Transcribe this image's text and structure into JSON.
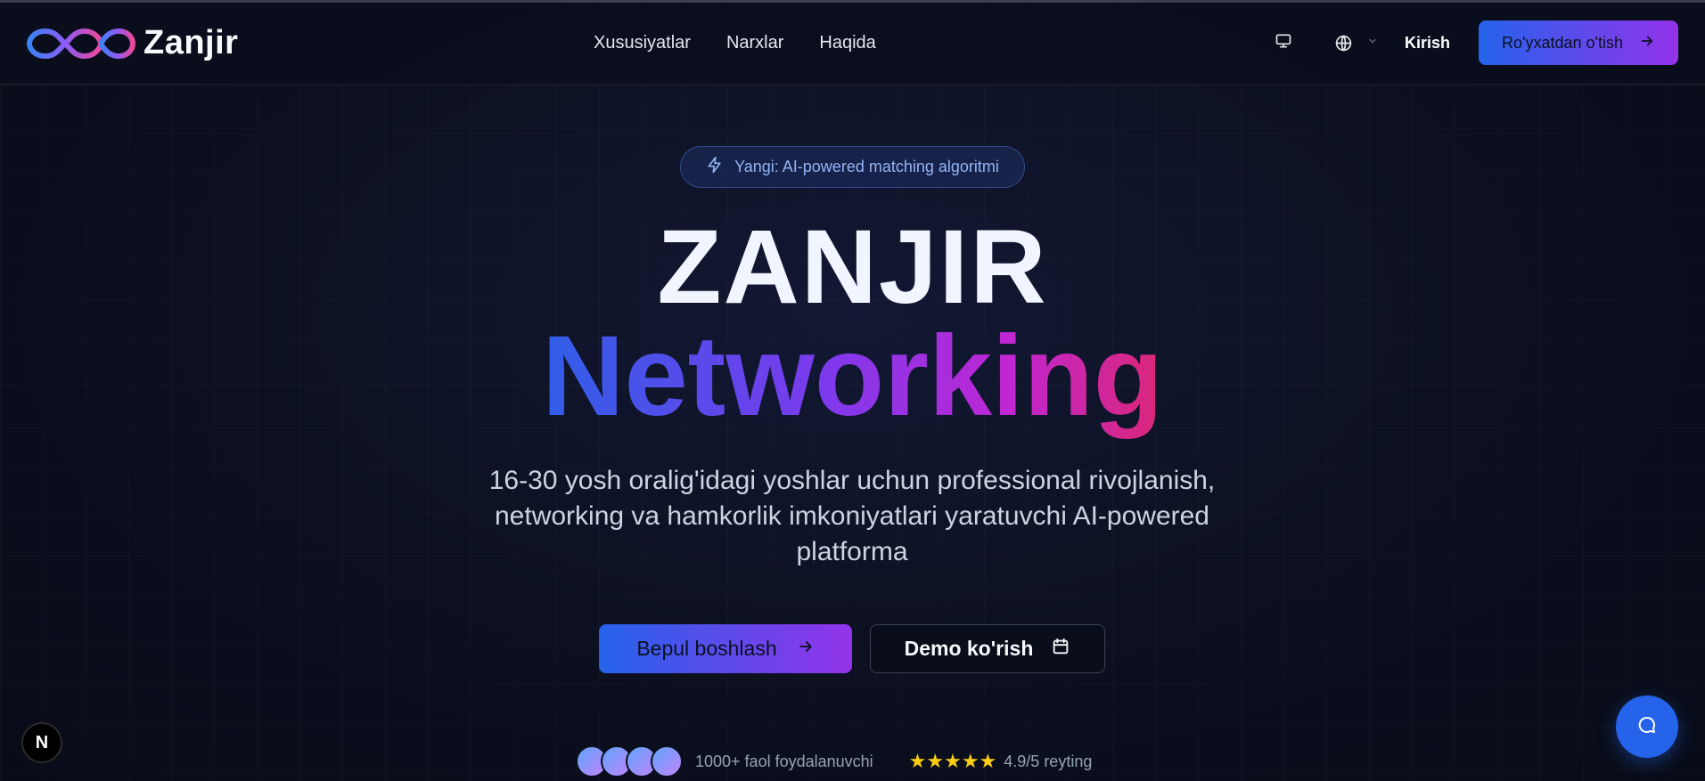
{
  "brand": {
    "name": "Zanjir",
    "logo_icon": "infinity-chain-icon"
  },
  "nav": {
    "links": [
      "Xususiyatlar",
      "Narxlar",
      "Haqida"
    ],
    "theme_icon": "monitor-icon",
    "language_icon": "globe-icon",
    "login_label": "Kirish",
    "signup_label": "Ro'yxatdan o'tish"
  },
  "hero": {
    "badge": "Yangi: AI-powered matching algoritmi",
    "title": "ZANJIR",
    "subtitle": "Networking",
    "description": "16-30 yosh oralig'idagi yoshlar uchun professional rivojlanish, networking va hamkorlik imkoniyatlari yaratuvchi AI-powered platforma",
    "cta_primary": "Bepul boshlash",
    "cta_secondary": "Demo ko'rish"
  },
  "proof": {
    "users": "1000+ faol foydalanuvchi",
    "stars": "★★★★★",
    "rating": "4.9/5 reyting"
  },
  "floating": {
    "next_badge": "N",
    "chat_icon": "chat-bubble-icon"
  },
  "colors": {
    "accent_start": "#2563eb",
    "accent_end": "#9333ea",
    "background": "#0b0f1e",
    "star": "#facc15"
  }
}
